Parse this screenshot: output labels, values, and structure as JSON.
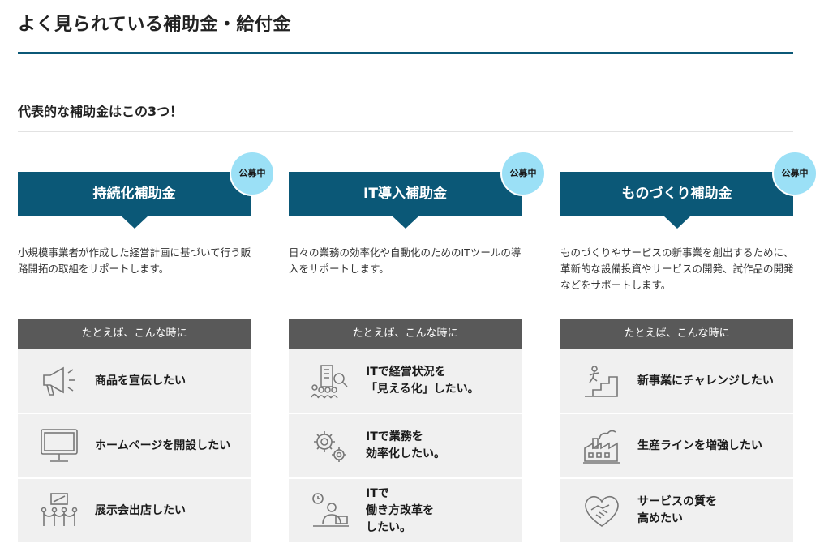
{
  "page_title": "よく見られている補助金・給付金",
  "subtitle": "代表的な補助金はこの3つ！",
  "columns": [
    {
      "title": "持続化補助金",
      "badge": "公募中",
      "description": "小規模事業者が作成した経営計画に基づいて行う販路開拓の取組をサポートします。",
      "example_header": "たとえば、こんな時に",
      "items": [
        {
          "icon": "megaphone-icon",
          "text": "商品を宣伝したい"
        },
        {
          "icon": "monitor-icon",
          "text": "ホームページを開設したい"
        },
        {
          "icon": "exhibition-icon",
          "text": "展示会出店したい"
        }
      ]
    },
    {
      "title": "IT導入補助金",
      "badge": "公募中",
      "description": "日々の業務の効率化や自動化のためのITツールの導入をサポートします。",
      "example_header": "たとえば、こんな時に",
      "items": [
        {
          "icon": "business-analysis-icon",
          "text": "ITで経営状況を\n「見える化」したい。"
        },
        {
          "icon": "gears-icon",
          "text": "ITで業務を\n効率化したい。"
        },
        {
          "icon": "remote-work-icon",
          "text": "ITで\n働き方改革を\nしたい。"
        }
      ]
    },
    {
      "title": "ものづくり補助金",
      "badge": "公募中",
      "description": "ものづくりやサービスの新事業を創出するために、革新的な設備投資やサービスの開発、試作品の開発などをサポートします。",
      "example_header": "たとえば、こんな時に",
      "items": [
        {
          "icon": "stairs-climb-icon",
          "text": "新事業にチャレンジしたい"
        },
        {
          "icon": "factory-icon",
          "text": "生産ラインを増強したい"
        },
        {
          "icon": "handshake-heart-icon",
          "text": "サービスの質を\n高めたい"
        }
      ]
    }
  ]
}
